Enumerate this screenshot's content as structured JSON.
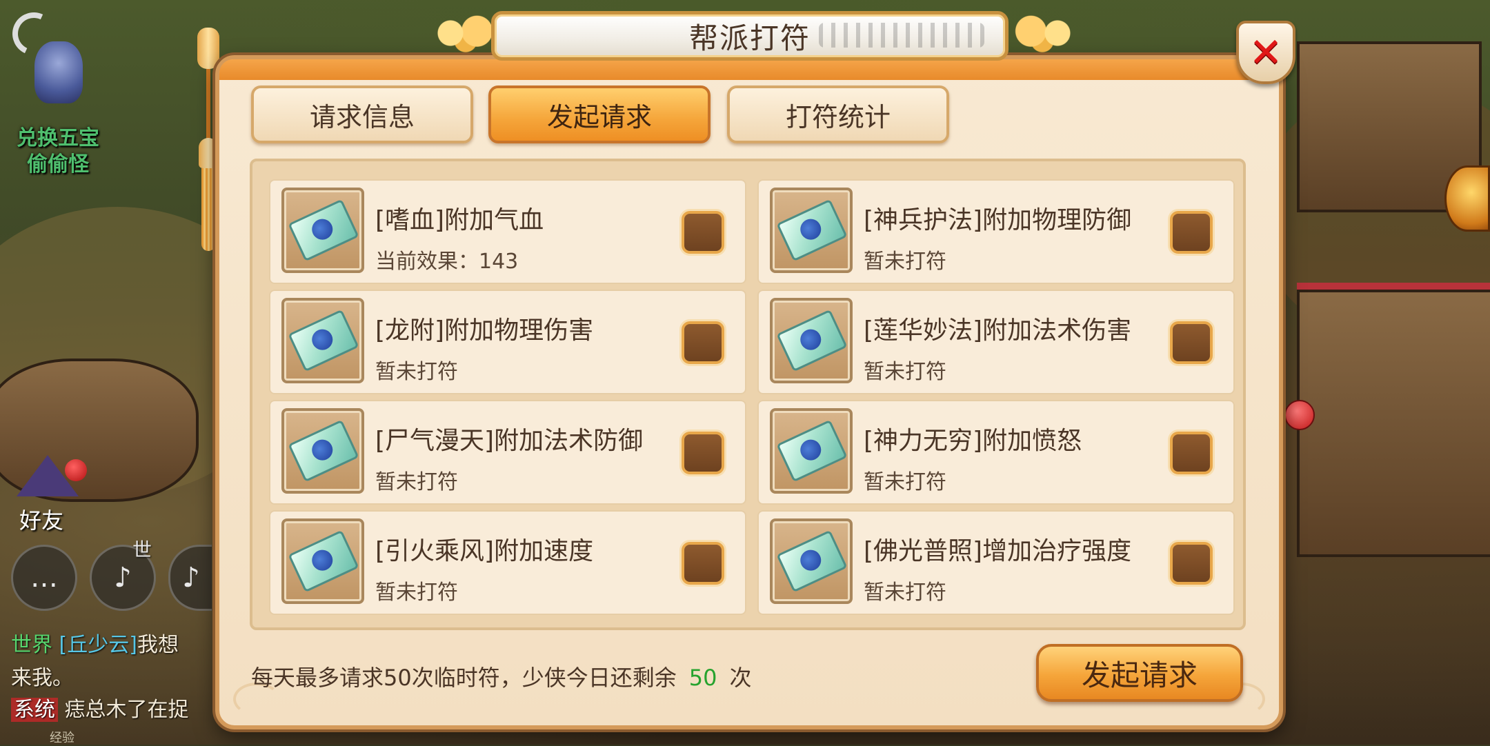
{
  "scene": {
    "npc_label_line1": "兑换五宝",
    "npc_label_line2": "偷偷怪",
    "friend_label": "好友",
    "voice_world_tag": "世",
    "chat": [
      {
        "channel": "世界",
        "name": "[丘少云]",
        "text": "我想"
      },
      {
        "channel": "",
        "name": "",
        "text": "来我。"
      },
      {
        "channel": "系统",
        "name": "",
        "text": "痣总木了在捉"
      }
    ],
    "exp_label": "经验"
  },
  "dialog": {
    "title": "帮派打符",
    "close_icon": "close-x-icon",
    "tabs": [
      {
        "label": "请求信息",
        "active": false
      },
      {
        "label": "发起请求",
        "active": true
      },
      {
        "label": "打符统计",
        "active": false
      }
    ],
    "items": [
      {
        "title": "[嗜血]附加气血",
        "status": "当前效果：143",
        "checked": false
      },
      {
        "title": "[神兵护法]附加物理防御",
        "status": "暂未打符",
        "checked": false
      },
      {
        "title": "[龙附]附加物理伤害",
        "status": "暂未打符",
        "checked": false
      },
      {
        "title": "[莲华妙法]附加法术伤害",
        "status": "暂未打符",
        "checked": false
      },
      {
        "title": "[尸气漫天]附加法术防御",
        "status": "暂未打符",
        "checked": false
      },
      {
        "title": "[神力无穷]附加愤怒",
        "status": "暂未打符",
        "checked": false
      },
      {
        "title": "[引火乘风]附加速度",
        "status": "暂未打符",
        "checked": false
      },
      {
        "title": "[佛光普照]增加治疗强度",
        "status": "暂未打符",
        "checked": false
      }
    ],
    "footer": {
      "prefix": "每天最多请求50次临时符，少侠今日还剩余",
      "remaining": "50",
      "suffix": "次"
    },
    "submit_label": "发起请求"
  },
  "colors": {
    "panel_bg": "#f8e9d2",
    "tab_active": "#f5a53a",
    "remaining_green": "#27a32e",
    "close_red": "#e01818"
  }
}
